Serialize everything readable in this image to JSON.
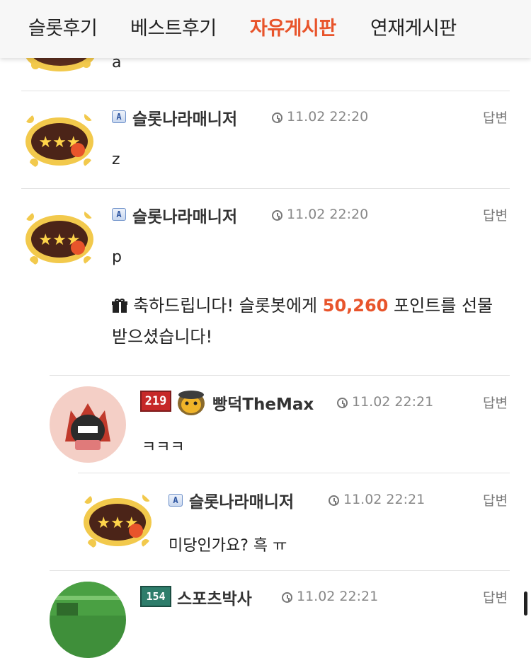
{
  "nav": {
    "tabs": [
      {
        "label": "슬롯후기"
      },
      {
        "label": "베스트후기"
      },
      {
        "label": "자유게시판",
        "active": true
      },
      {
        "label": "연재게시판"
      }
    ]
  },
  "colors": {
    "accent": "#e8542b"
  },
  "comments": [
    {
      "text": "a"
    },
    {
      "author": "슬롯나라매니저",
      "badge": "A",
      "time": "11.02 22:20",
      "reply": "답변",
      "text": "z"
    },
    {
      "author": "슬롯나라매니저",
      "badge": "A",
      "time": "11.02 22:20",
      "reply": "답변",
      "text": "p",
      "gift": {
        "prefix": "축하드립니다! 슬롯봇에게 ",
        "points": "50,260",
        "suffix": " 포인트를 선물받으셨습니다!"
      }
    },
    {
      "author": "빵덕TheMax",
      "level": "219",
      "time": "11.02 22:21",
      "reply": "답변",
      "text": "ㅋㅋㅋ"
    },
    {
      "author": "슬롯나라매니저",
      "badge": "A",
      "time": "11.02 22:21",
      "reply": "답변",
      "text": "미당인가요? 흑 ㅠ"
    },
    {
      "author": "스포츠박사",
      "level": "154",
      "time": "11.02 22:21",
      "reply": "답변"
    }
  ]
}
